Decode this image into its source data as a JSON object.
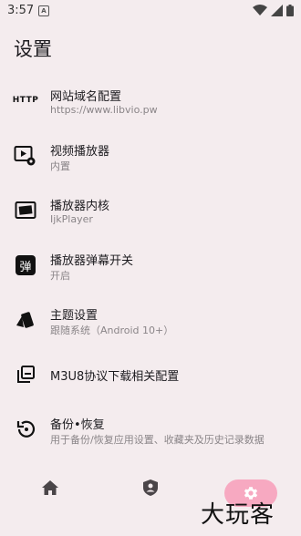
{
  "status_bar": {
    "time": "3:57",
    "notification_badge": "A"
  },
  "page": {
    "title": "设置"
  },
  "settings": [
    {
      "icon": "http-icon",
      "icon_text": "HTTP",
      "title": "网站域名配置",
      "subtitle": "https://www.libvio.pw"
    },
    {
      "icon": "video-player-settings-icon",
      "title": "视频播放器",
      "subtitle": "内置"
    },
    {
      "icon": "player-kernel-icon",
      "title": "播放器内核",
      "subtitle": "IjkPlayer"
    },
    {
      "icon": "danmaku-icon",
      "icon_text": "弹",
      "title": "播放器弹幕开关",
      "subtitle": "开启"
    },
    {
      "icon": "theme-palette-icon",
      "title": "主题设置",
      "subtitle": "跟随系统（Android 10+）"
    },
    {
      "icon": "library-icon",
      "title": "M3U8协议下载相关配置",
      "subtitle": ""
    },
    {
      "icon": "restore-icon",
      "title": "备份•恢复",
      "subtitle": "用于备份/恢复应用设置、收藏夹及历史记录数据"
    }
  ],
  "bottom_nav": {
    "items": [
      {
        "icon": "home-icon"
      },
      {
        "icon": "account-icon"
      },
      {
        "icon": "settings-gear-icon",
        "active": true
      }
    ]
  },
  "watermark": "大玩客",
  "colors": {
    "background": "#f4ecee",
    "active_nav": "#f7a9c1",
    "subtitle": "#8a8588"
  }
}
